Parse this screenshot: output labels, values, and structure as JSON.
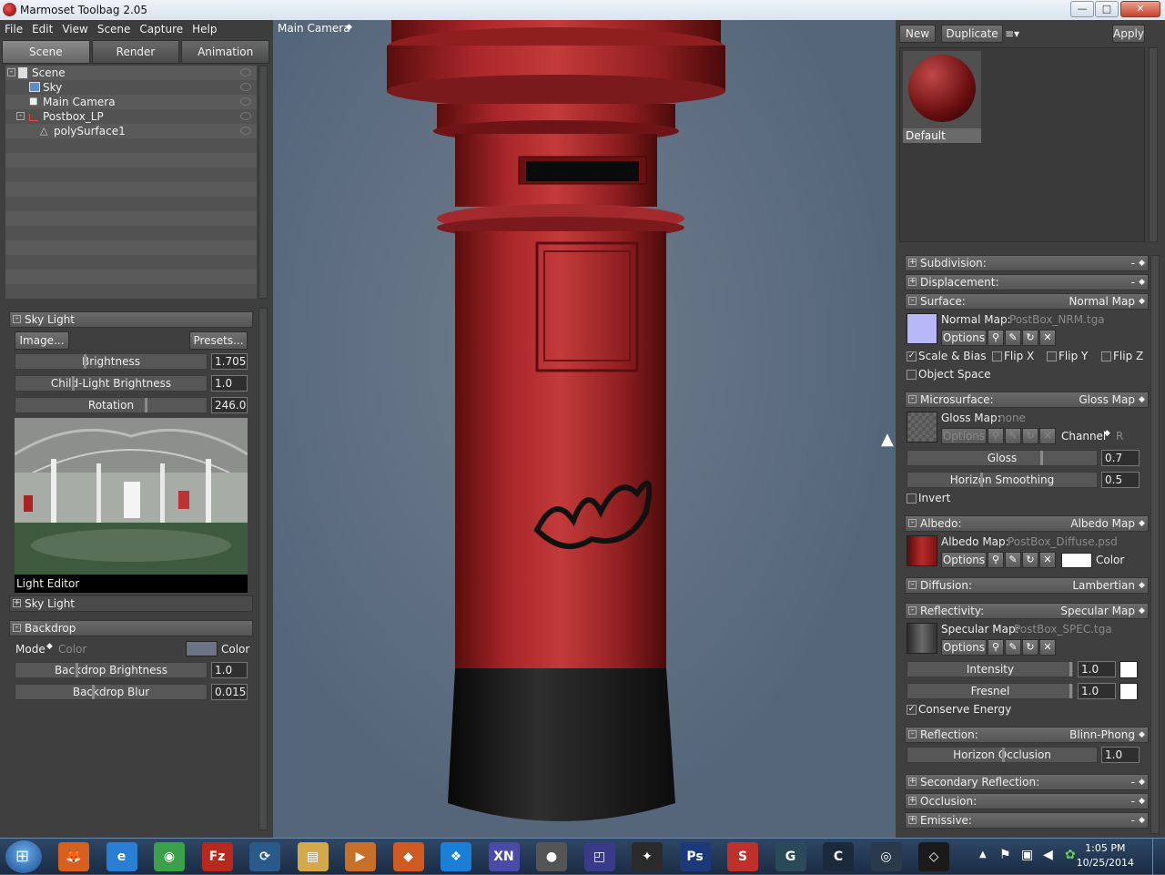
{
  "window": {
    "title": "Marmoset Toolbag 2.05",
    "min": "—",
    "max": "□",
    "close": "✕"
  },
  "menu": [
    "File",
    "Edit",
    "View",
    "Scene",
    "Capture",
    "Help"
  ],
  "tabs": [
    "Scene",
    "Render",
    "Animation"
  ],
  "tree": [
    {
      "label": "Scene",
      "icon": "scene-icon"
    },
    {
      "label": "Sky",
      "icon": "sky-icon"
    },
    {
      "label": "Main Camera",
      "icon": "camera-icon"
    },
    {
      "label": "Postbox_LP",
      "icon": "group-icon"
    },
    {
      "label": "polySurface1",
      "icon": "mesh-icon"
    }
  ],
  "skylight": {
    "title": "Sky Light",
    "image_btn": "Image...",
    "presets_btn": "Presets...",
    "brightness_label": "Brightness",
    "brightness_value": "1.705",
    "child_label": "Child-Light Brightness",
    "child_value": "1.0",
    "rotation_label": "Rotation",
    "rotation_value": "246.0",
    "light_editor": "Light Editor",
    "sub_section": "Sky Light"
  },
  "backdrop": {
    "title": "Backdrop",
    "mode_label": "Mode",
    "mode_value": "Color",
    "color_label": "Color",
    "color": "#6a7484",
    "brightness_label": "Backdrop Brightness",
    "brightness_value": "1.0",
    "blur_label": "Backdrop Blur",
    "blur_value": "0.015"
  },
  "viewport": {
    "camera": "Main Camera"
  },
  "material": {
    "new_btn": "New",
    "dup_btn": "Duplicate",
    "menu_icon": "≡▾",
    "apply_btn": "Apply",
    "name": "Default"
  },
  "sections": {
    "subdivision": {
      "label": "Subdivision:",
      "value": "-"
    },
    "displacement": {
      "label": "Displacement:",
      "value": "-"
    },
    "surface": {
      "label": "Surface:",
      "value": "Normal Map",
      "map_label": "Normal Map:",
      "map_file": "PostBox_NRM.tga",
      "scale_bias": "Scale & Bias",
      "flip_x": "Flip X",
      "flip_y": "Flip Y",
      "flip_z": "Flip Z",
      "object_space": "Object Space"
    },
    "microsurface": {
      "label": "Microsurface:",
      "value": "Gloss Map",
      "map_label": "Gloss Map:",
      "map_file": "none",
      "channel_label": "Channel",
      "channel_value": "R",
      "gloss_label": "Gloss",
      "gloss_value": "0.7",
      "horizon_label": "Horizon Smoothing",
      "horizon_value": "0.5",
      "invert": "Invert"
    },
    "albedo": {
      "label": "Albedo:",
      "value": "Albedo Map",
      "map_label": "Albedo Map:",
      "map_file": "PostBox_Diffuse.psd",
      "color_label": "Color"
    },
    "diffusion": {
      "label": "Diffusion:",
      "value": "Lambertian"
    },
    "reflectivity": {
      "label": "Reflectivity:",
      "value": "Specular Map",
      "map_label": "Specular Map:",
      "map_file": "PostBox_SPEC.tga",
      "intensity_label": "Intensity",
      "intensity_value": "1.0",
      "fresnel_label": "Fresnel",
      "fresnel_value": "1.0",
      "conserve": "Conserve Energy"
    },
    "reflection": {
      "label": "Reflection:",
      "value": "Blinn-Phong",
      "occlusion_label": "Horizon Occlusion",
      "occlusion_value": "1.0"
    },
    "secondary": {
      "label": "Secondary Reflection:",
      "value": "-"
    },
    "occlusion": {
      "label": "Occlusion:",
      "value": "-"
    },
    "emissive": {
      "label": "Emissive:",
      "value": "-"
    }
  },
  "options_label": "Options",
  "taskbar": {
    "apps": [
      {
        "name": "firefox",
        "glyph": "🦊",
        "color": "#d8601e"
      },
      {
        "name": "internet-explorer",
        "glyph": "e",
        "color": "#2a7fd4"
      },
      {
        "name": "chrome",
        "glyph": "◉",
        "color": "#3aa04a"
      },
      {
        "name": "filezilla",
        "glyph": "Fz",
        "color": "#b8281c"
      },
      {
        "name": "app-sync",
        "glyph": "⟳",
        "color": "#2a5a8a"
      },
      {
        "name": "explorer",
        "glyph": "▤",
        "color": "#d4a94a"
      },
      {
        "name": "media-player",
        "glyph": "▶",
        "color": "#c8702a"
      },
      {
        "name": "matlab",
        "glyph": "◆",
        "color": "#d05a20"
      },
      {
        "name": "dropbox",
        "glyph": "❖",
        "color": "#1b7fd8"
      },
      {
        "name": "xn-viewer",
        "glyph": "XN",
        "color": "#4a4aa8"
      },
      {
        "name": "marmoset",
        "glyph": "●",
        "color": "#555555"
      },
      {
        "name": "marvelous",
        "glyph": "◰",
        "color": "#3a3a8a"
      },
      {
        "name": "zbrush",
        "glyph": "✦",
        "color": "#2a2a2a"
      },
      {
        "name": "photoshop",
        "glyph": "Ps",
        "color": "#1a3a7a"
      },
      {
        "name": "substance",
        "glyph": "S",
        "color": "#c0302a"
      },
      {
        "name": "3dsmax",
        "glyph": "G",
        "color": "#2a4a5a"
      },
      {
        "name": "cinema-app",
        "glyph": "C",
        "color": "#1a2a3a"
      },
      {
        "name": "camera-app",
        "glyph": "◎",
        "color": "#2a3a4a"
      },
      {
        "name": "unity",
        "glyph": "◇",
        "color": "#1a1a1a"
      }
    ],
    "time": "1:05 PM",
    "date": "10/25/2014"
  }
}
